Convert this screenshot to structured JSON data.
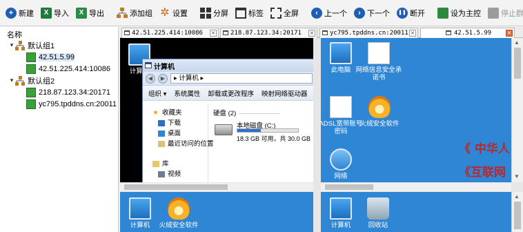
{
  "toolbar": {
    "buttons": [
      {
        "label": "新建",
        "icon": "plus-circle-icon"
      },
      {
        "label": "导入",
        "icon": "excel-import-icon"
      },
      {
        "label": "导出",
        "icon": "excel-export-icon"
      },
      {
        "label": "添加组",
        "icon": "add-group-icon"
      },
      {
        "label": "设置",
        "icon": "gear-icon"
      },
      {
        "label": "分屏",
        "icon": "split-screen-icon"
      },
      {
        "label": "标签",
        "icon": "tab-icon"
      },
      {
        "label": "全屏",
        "icon": "fullscreen-icon"
      },
      {
        "label": "上一个",
        "icon": "arrow-left-circle-icon"
      },
      {
        "label": "下一个",
        "icon": "arrow-right-circle-icon"
      },
      {
        "label": "断开",
        "icon": "disconnect-icon"
      },
      {
        "label": "设为主控",
        "icon": "set-master-icon"
      },
      {
        "label": "停止群控",
        "icon": "stop-group-control-icon"
      }
    ],
    "glyphs": {
      "plus": "+",
      "excel": "X",
      "gear": "✲",
      "prev": "‹",
      "next": "›",
      "pause": "❚❚"
    }
  },
  "tree": {
    "header": "名称",
    "arrow": "▾",
    "groups": [
      {
        "name": "默认组1",
        "items": [
          "42.51.5.99",
          "42.51.225.414:10086"
        ]
      },
      {
        "name": "默认组2",
        "items": [
          "218.87.123.34:20171",
          "yc795.tpddns.cn:20011"
        ]
      }
    ]
  },
  "tabs": [
    {
      "label": "42.51.225.414:10086",
      "close": "×"
    },
    {
      "label": "218.87.123.34:20171",
      "close": "×"
    },
    {
      "label": "yc795.tpddns.cn:20011",
      "close": "×"
    },
    {
      "label": "42.51.5.99",
      "close": "×",
      "active": true
    }
  ],
  "pane_tl": {
    "desktop_icon": "计算机",
    "explorer": {
      "title": "计算机",
      "nav_back": "◀",
      "nav_fwd": "▶",
      "address": "▸ 计算机 ▸",
      "menu": [
        "组织 ▾",
        "系统属性",
        "卸载或更改程序",
        "映射网络驱动器"
      ],
      "nav_items": [
        "收藏夹",
        "下载",
        "桌面",
        "最近访问的位置",
        "库",
        "视频"
      ],
      "drive_header": "硬盘 (2)",
      "drive_name": "本地磁盘 (C:)",
      "drive_free": "18.3 GB 可用，共 30.0 GB",
      "drive_fill": 0.39
    }
  },
  "pane_tr": {
    "icons": [
      "此电脑",
      "网络信息安全承诺书",
      "ADSL宽带账号密码",
      "火绒安全软件",
      "网络"
    ],
    "red_text_1": "《 中华人",
    "red_text_2": "《互联网"
  },
  "pane_bl": {
    "icons": [
      "计算机",
      "火绒安全软件"
    ]
  },
  "pane_br": {
    "icons": [
      "计算机",
      "回收站"
    ]
  },
  "scroll": {
    "up": "▲",
    "down": "▼"
  },
  "colors": {
    "desktop_blue": "#2f86d4",
    "accent": "#1e5fb4",
    "active_close": "#e06b3a"
  }
}
